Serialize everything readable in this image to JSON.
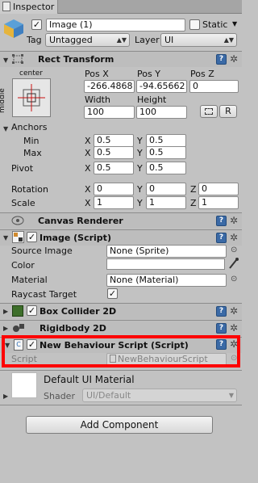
{
  "tab": {
    "label": "Inspector"
  },
  "header": {
    "name_value": "Image (1)",
    "static_label": "Static",
    "tag_label": "Tag",
    "tag_value": "Untagged",
    "layer_label": "Layer",
    "layer_value": "UI"
  },
  "rect_transform": {
    "title": "Rect Transform",
    "anchor_preset_top": "center",
    "anchor_preset_side": "middle",
    "col_posx": "Pos X",
    "col_posy": "Pos Y",
    "col_posz": "Pos Z",
    "posx": "-266.4868",
    "posy": "-94.65662",
    "posz": "0",
    "col_width": "Width",
    "col_height": "Height",
    "width": "100",
    "height": "100",
    "raw_button": "R",
    "anchors_label": "Anchors",
    "min_label": "Min",
    "max_label": "Max",
    "pivot_label": "Pivot",
    "min_x": "0.5",
    "min_y": "0.5",
    "max_x": "0.5",
    "max_y": "0.5",
    "pivot_x": "0.5",
    "pivot_y": "0.5",
    "rotation_label": "Rotation",
    "scale_label": "Scale",
    "rot_x": "0",
    "rot_y": "0",
    "rot_z": "0",
    "scale_x": "1",
    "scale_y": "1",
    "scale_z": "1",
    "x": "X",
    "y": "Y",
    "z": "Z"
  },
  "canvas_renderer": {
    "title": "Canvas Renderer"
  },
  "image_script": {
    "title": "Image (Script)",
    "source_image_label": "Source Image",
    "source_image_value": "None (Sprite)",
    "color_label": "Color",
    "material_label": "Material",
    "material_value": "None (Material)",
    "raycast_label": "Raycast Target"
  },
  "box_collider": {
    "title": "Box Collider 2D"
  },
  "rigidbody": {
    "title": "Rigidbody 2D"
  },
  "behaviour": {
    "title": "New Behaviour Script (Script)",
    "script_label": "Script",
    "script_value": "NewBehaviourScript"
  },
  "material": {
    "title": "Default UI Material",
    "shader_label": "Shader",
    "shader_value": "UI/Default"
  },
  "add_component": {
    "label": "Add Component"
  },
  "colors": {
    "highlight": "#ff0000",
    "help": "#3b6aa6"
  }
}
